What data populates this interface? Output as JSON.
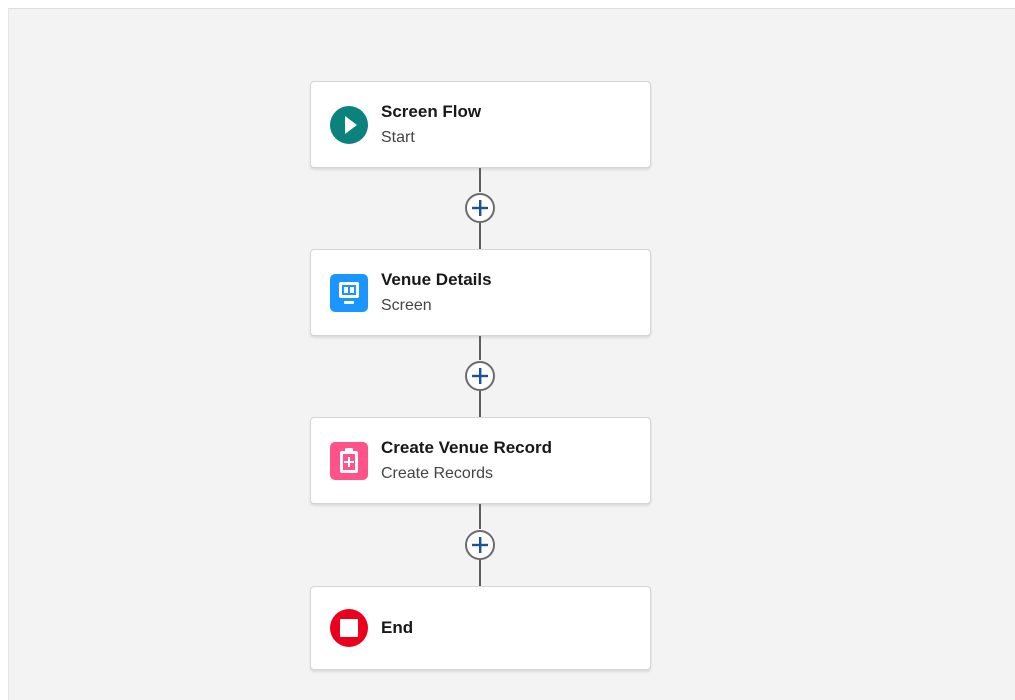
{
  "flow": {
    "nodes": [
      {
        "title": "Screen Flow",
        "subtitle": "Start",
        "icon": "start-play-icon",
        "color": "#0b827c"
      },
      {
        "title": "Venue Details",
        "subtitle": "Screen",
        "icon": "screen-icon",
        "color": "#1b96ff"
      },
      {
        "title": "Create Venue Record",
        "subtitle": "Create Records",
        "icon": "create-record-icon",
        "color": "#ff538a"
      },
      {
        "title": "End",
        "subtitle": "",
        "icon": "end-stop-icon",
        "color": "#ea001e"
      }
    ],
    "add_element_icon": "plus-icon"
  }
}
